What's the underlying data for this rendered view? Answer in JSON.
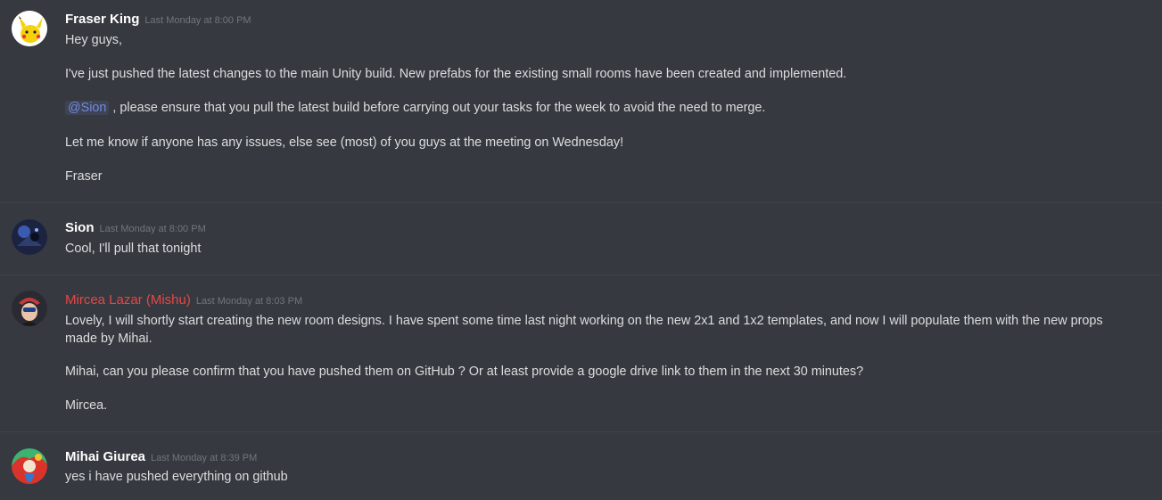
{
  "messages": [
    {
      "author": "Fraser King",
      "timestamp": "Last Monday at 8:00 PM",
      "avatar_icon": "pikachu-avatar-icon",
      "lines": [
        "Hey guys,",
        "I've just pushed the latest changes to the main Unity build. New prefabs for the existing small rooms have been created and implemented.",
        ", please ensure that you pull the latest build before carrying out your tasks for the week to avoid the need to merge.",
        "Let me know if anyone has any issues, else see (most) of you guys at the meeting on Wednesday!",
        "Fraser"
      ],
      "mention": "@Sion"
    },
    {
      "author": "Sion",
      "timestamp": "Last Monday at 8:00 PM",
      "avatar_icon": "dark-blue-avatar-icon",
      "lines": [
        "Cool, I'll pull that tonight"
      ]
    },
    {
      "author": "Mircea Lazar (Mishu)",
      "timestamp": "Last Monday at 8:03 PM",
      "avatar_icon": "character-avatar-icon",
      "author_color": "#e84646",
      "lines": [
        "Lovely, I will shortly start creating the new room designs. I have spent some time last night working on the new 2x1 and 1x2 templates, and now I will populate them with the new props made by Mihai.",
        "Mihai, can you please confirm that you have pushed them on GitHub ? Or at least provide a google drive link to them in the next 30 minutes?",
        "Mircea."
      ]
    },
    {
      "author": "Mihai Giurea",
      "timestamp": "Last Monday at 8:39 PM",
      "avatar_icon": "colorful-avatar-icon",
      "lines": [
        "yes i have pushed everything on github"
      ]
    }
  ]
}
